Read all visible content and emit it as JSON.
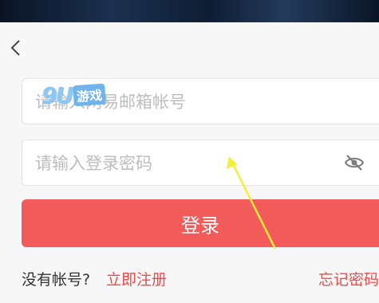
{
  "nav": {
    "back_icon": "chevron-left-icon"
  },
  "form": {
    "account_placeholder": "请输入网易邮箱帐号",
    "password_placeholder": "请输入登录密码",
    "visibility_icon": "eye-off-icon",
    "login_label": "登录"
  },
  "footer": {
    "no_account": "没有帐号?",
    "register": "立即注册",
    "forgot": "忘记密码"
  },
  "watermark": {
    "main": "9U",
    "badge": "游戏"
  },
  "colors": {
    "accent": "#f35b5a",
    "link": "#ef4a4a",
    "background": "#f7f7f7",
    "annotation_arrow": "#f3ee3a"
  }
}
